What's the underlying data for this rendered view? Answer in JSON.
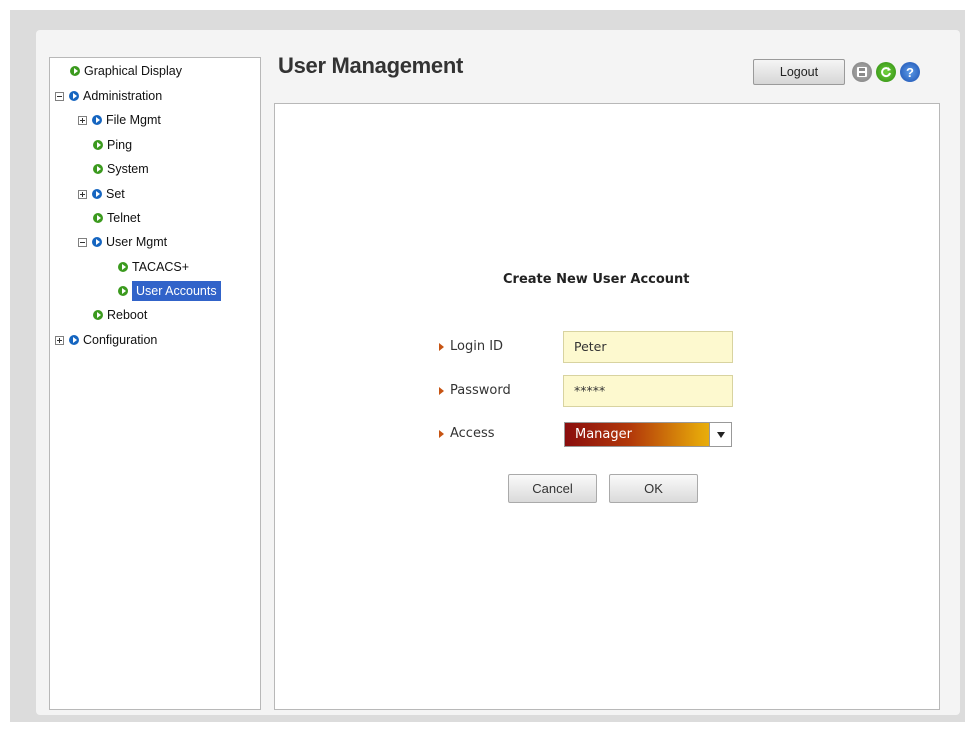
{
  "header": {
    "title": "User Management",
    "logout_label": "Logout",
    "icons": [
      "save-icon",
      "refresh-icon",
      "help-icon"
    ]
  },
  "sidebar": {
    "items": [
      {
        "label": "Graphical Display",
        "icon": "green",
        "expander": null
      },
      {
        "label": "Administration",
        "icon": "blue",
        "expander": "minus"
      },
      {
        "label": "File Mgmt",
        "icon": "blue",
        "expander": "plus"
      },
      {
        "label": "Ping",
        "icon": "green",
        "expander": null
      },
      {
        "label": "System",
        "icon": "green",
        "expander": null
      },
      {
        "label": "Set",
        "icon": "blue",
        "expander": "plus"
      },
      {
        "label": "Telnet",
        "icon": "green",
        "expander": null
      },
      {
        "label": "User Mgmt",
        "icon": "blue",
        "expander": "minus"
      },
      {
        "label": "TACACS+",
        "icon": "green",
        "expander": null
      },
      {
        "label": "User Accounts",
        "icon": "green",
        "expander": null,
        "selected": true
      },
      {
        "label": "Reboot",
        "icon": "green",
        "expander": null
      },
      {
        "label": "Configuration",
        "icon": "blue",
        "expander": "plus"
      }
    ]
  },
  "form": {
    "title": "Create New User Account",
    "login_label": "Login ID",
    "login_value": "Peter",
    "password_label": "Password",
    "password_value": "*****",
    "access_label": "Access",
    "access_value": "Manager",
    "cancel_label": "Cancel",
    "ok_label": "OK"
  },
  "colors": {
    "selection": "#3163c9",
    "input_bg": "#fdf9cf",
    "label_arrow": "#c75413"
  }
}
